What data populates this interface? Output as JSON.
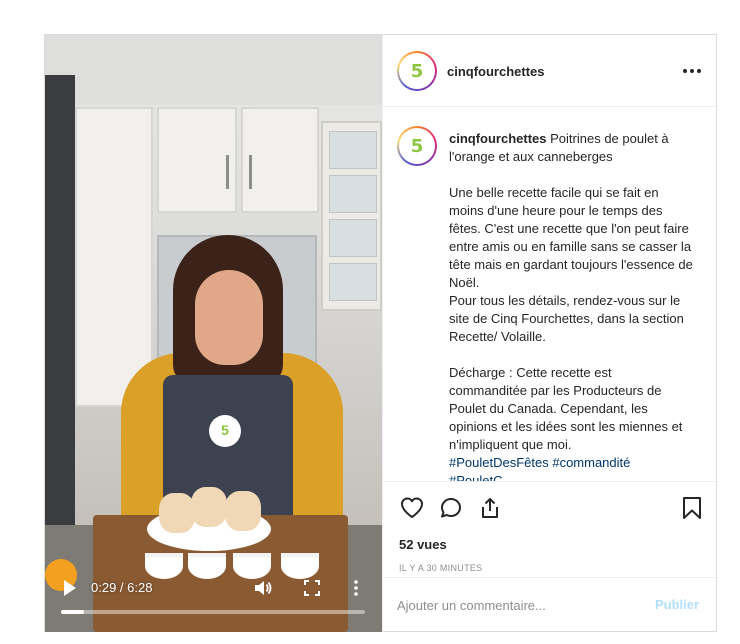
{
  "post": {
    "username": "cinqfourchettes",
    "avatar_text": "5",
    "caption": {
      "title": "Poitrines de poulet à l'orange et aux canneberges",
      "para1": "Une belle recette facile qui se fait en moins d'une heure pour le temps des fêtes. C'est une recette que l'on peut faire entre amis ou en famille sans se casser la tête mais en gardant toujours l'essence de Noël.",
      "para2": "Pour tous les détails, rendez-vous sur le site de Cinq Fourchettes, dans la section Recette/ Volaille.",
      "para3": "Décharge : Cette recette est commanditée par les Producteurs de Poulet du Canada. Cependant, les opinions et les idées sont les miennes et n'impliquent que moi.",
      "hashtags": "#PouletDesFêtes #commandité",
      "hashtags_more": "#PouletC..."
    },
    "views": "52 vues",
    "time_ago": "IL Y A 30 MINUTES"
  },
  "video": {
    "time": "0:29 / 6:28",
    "progress": 0.075,
    "apron_logo": "5"
  },
  "comment": {
    "placeholder": "Ajouter un commentaire...",
    "post_label": "Publier"
  },
  "colors": {
    "brand_green": "#8cc63f",
    "link_blue": "#00376b",
    "post_disabled": "#b2dffc"
  },
  "icons": [
    "play-icon",
    "volume-icon",
    "fullscreen-icon",
    "more-vertical-icon",
    "more-horizontal-icon",
    "heart-icon",
    "comment-icon",
    "share-icon",
    "bookmark-icon"
  ]
}
